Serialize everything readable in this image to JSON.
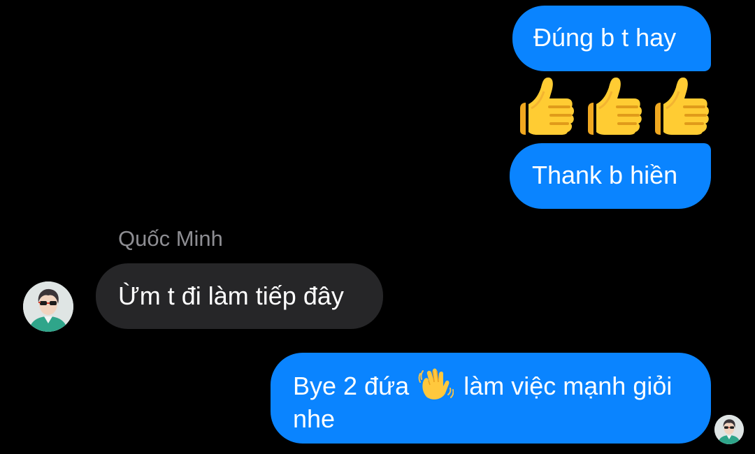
{
  "chat": {
    "messages": [
      {
        "direction": "outgoing",
        "text": "Đúng b t hay"
      },
      {
        "direction": "outgoing",
        "emoji": [
          "thumbs-up",
          "thumbs-up",
          "thumbs-up"
        ]
      },
      {
        "direction": "outgoing",
        "text": "Thank b hiền"
      },
      {
        "direction": "incoming",
        "sender": "Quốc Minh"
      },
      {
        "direction": "incoming",
        "text": "Ừm t đi làm tiếp đây"
      },
      {
        "direction": "outgoing",
        "text_before": "Bye 2 đứa",
        "emoji": "waving-hand",
        "text_after": "làm việc mạnh giỏi nhe"
      }
    ]
  },
  "colors": {
    "background": "#000000",
    "outgoing_bubble": "#0a84ff",
    "incoming_bubble": "#262628",
    "sender_name": "#8e8e93",
    "text": "#ffffff"
  },
  "icons": {
    "thumbs_up": "thumbs-up-icon",
    "waving_hand": "waving-hand-icon",
    "avatar": "avatar-photo"
  }
}
